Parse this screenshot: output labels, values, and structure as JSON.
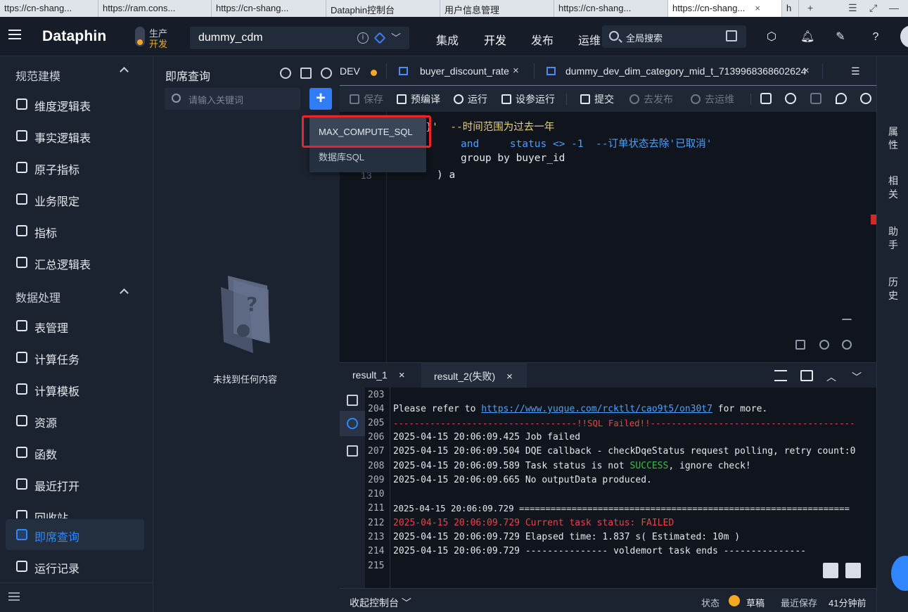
{
  "browser": {
    "tabs": [
      {
        "label": "ttps://cn-shang...",
        "active": false
      },
      {
        "label": "https://ram.cons...",
        "active": false
      },
      {
        "label": "https://cn-shang...",
        "active": false
      },
      {
        "label": "Dataphin控制台",
        "active": false
      },
      {
        "label": "用户信息管理",
        "active": false
      },
      {
        "label": "https://cn-shang...",
        "active": false
      },
      {
        "label": "https://cn-shang...",
        "active": true,
        "close": "×"
      },
      {
        "label": "h",
        "active": false
      }
    ],
    "new_tab": "+",
    "controls": {
      "list": "☰",
      "restore": "⤢",
      "minimize": "—"
    }
  },
  "header": {
    "logo": "Dataphin",
    "env": {
      "prod": "生产",
      "dev": "开发"
    },
    "project": "dummy_cdm",
    "nav": [
      "集成",
      "开发",
      "发布",
      "运维"
    ],
    "search_placeholder": "全局搜索"
  },
  "sidebar": {
    "section1": "规范建模",
    "items1": [
      "维度逻辑表",
      "事实逻辑表",
      "原子指标",
      "业务限定",
      "指标",
      "汇总逻辑表"
    ],
    "section2": "数据处理",
    "items2": [
      "表管理",
      "计算任务",
      "计算模板",
      "资源",
      "函数",
      "最近打开",
      "回收站",
      "即席查询",
      "运行记录"
    ]
  },
  "query_panel": {
    "title": "即席查询",
    "search_placeholder": "请输入关键词",
    "add_label": "+",
    "empty_text": "未找到任何内容"
  },
  "dropdown": {
    "options": [
      "MAX_COMPUTE_SQL",
      "数据库SQL"
    ],
    "highlight_color": "#e8262a"
  },
  "editor_tabs": [
    {
      "label": "DEV",
      "modified": true
    },
    {
      "label": "buyer_discount_rate",
      "close": "×"
    },
    {
      "label": "dummy_dev_dim_category_mid_t_7139968368602624",
      "close": "×"
    }
  ],
  "toolbar": {
    "save": "保存",
    "precompile": "预编译",
    "run": "运行",
    "param_run": "设参运行",
    "submit": "提交",
    "publish": "去发布",
    "ops": "去运维"
  },
  "editor": {
    "lines": [
      {
        "num": "",
        "text": "te-365}'  --时间范围为过去一年"
      },
      {
        "num": "",
        "text": "and     status <> -1  --订单状态去除'已取消'"
      },
      {
        "num": "",
        "text": "group by buyer_id"
      },
      {
        "num": "13",
        "text": ") a"
      }
    ]
  },
  "right_rail": [
    "属性",
    "相关",
    "助手",
    "历史"
  ],
  "result": {
    "tabs": [
      {
        "label": "result_1",
        "close": "×",
        "active": false
      },
      {
        "label": "result_2(失败)",
        "close": "×",
        "active": true
      }
    ],
    "log_lines": [
      {
        "num": "203",
        "text": ""
      },
      {
        "num": "204",
        "text": "Please refer to ",
        "link": "https://www.yuque.com/rcktlt/cao9t5/on30t7",
        "after": " for more."
      },
      {
        "num": "205",
        "text": "-----------------------------------!!SQL Failed!!---------------------------------------",
        "style": "red"
      },
      {
        "num": "206",
        "text": "2025-04-15 20:06:09.425 Job failed"
      },
      {
        "num": "207",
        "text": "2025-04-15 20:06:09.504 DQE callback - checkDqeStatus request polling, retry count:0"
      },
      {
        "num": "208",
        "text": "2025-04-15 20:06:09.589 Task status is not ",
        "green": "SUCCESS",
        "after": ", ignore check!"
      },
      {
        "num": "209",
        "text": "2025-04-15 20:06:09.665 No outputData produced."
      },
      {
        "num": "210",
        "text": ""
      },
      {
        "num": "211",
        "text": "2025-04-15 20:06:09.729 ==============================================================="
      },
      {
        "num": "212",
        "text": "2025-04-15 20:06:09.729 Current task status: FAILED",
        "style": "red"
      },
      {
        "num": "213",
        "text": "2025-04-15 20:06:09.729 Elapsed time: 1.837 s( Estimated: 10m )"
      },
      {
        "num": "214",
        "text": "2025-04-15 20:06:09.729 --------------- voldemort task ends ---------------"
      },
      {
        "num": "215",
        "text": ""
      }
    ]
  },
  "statusbar": {
    "collapse": "收起控制台",
    "status_label": "状态",
    "status_value": "草稿",
    "saved_label": "最近保存",
    "saved_value": "41分钟前"
  },
  "colors": {
    "accent": "#2f86ff",
    "warning": "#f5a623",
    "error": "#e8434a"
  }
}
